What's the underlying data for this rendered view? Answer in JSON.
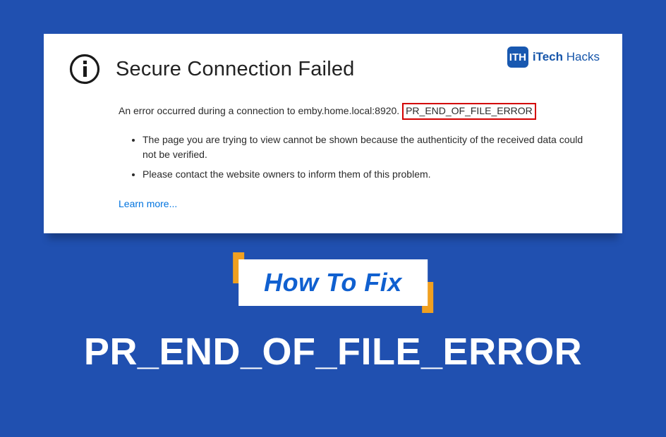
{
  "logo": {
    "badge": "ITH",
    "brand_i": "i",
    "brand_tech": "Tech",
    "brand_hacks": "Hacks"
  },
  "error": {
    "title": "Secure Connection Failed",
    "line_pre": "An error occurred during a connection to emby.home.local:8920. ",
    "code": "PR_END_OF_FILE_ERROR",
    "bullet1": "The page you are trying to view cannot be shown because the authenticity of the received data could not be verified.",
    "bullet2": "Please contact the website owners to inform them of this problem.",
    "learn": "Learn more..."
  },
  "banner": {
    "label": "How To Fix"
  },
  "headline": "PR_END_OF_FILE_ERROR"
}
